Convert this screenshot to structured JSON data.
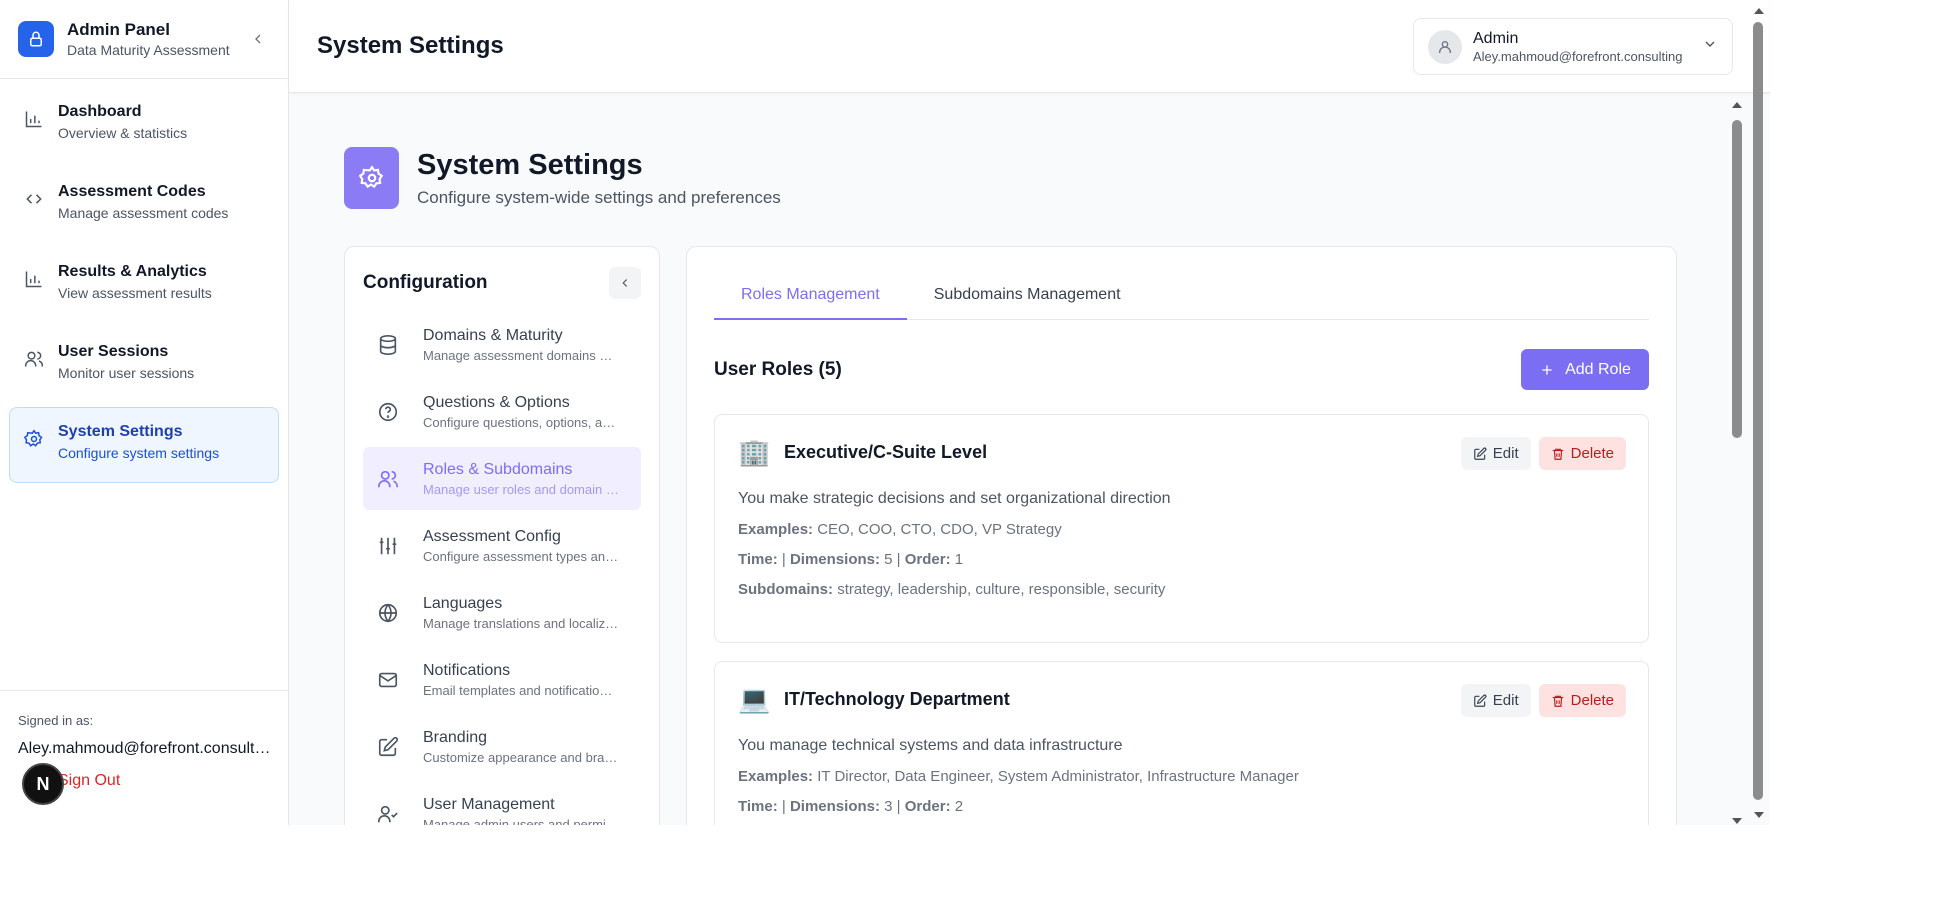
{
  "brand": {
    "title": "Admin Panel",
    "subtitle": "Data Maturity Assessment"
  },
  "sidebar": {
    "items": [
      {
        "title": "Dashboard",
        "desc": "Overview & statistics",
        "icon": "bar-chart-icon"
      },
      {
        "title": "Assessment Codes",
        "desc": "Manage assessment codes",
        "icon": "code-icon"
      },
      {
        "title": "Results & Analytics",
        "desc": "View assessment results",
        "icon": "bar-chart-icon"
      },
      {
        "title": "User Sessions",
        "desc": "Monitor user sessions",
        "icon": "users-icon"
      },
      {
        "title": "System Settings",
        "desc": "Configure system settings",
        "icon": "gear-icon",
        "active": true
      }
    ],
    "signed_label": "Signed in as:",
    "signed_email": "Aley.mahmoud@forefront.consulting",
    "signout": "Sign Out",
    "badge": "N"
  },
  "header": {
    "title": "System Settings",
    "user_name": "Admin",
    "user_email": "Aley.mahmoud@forefront.consulting"
  },
  "page": {
    "title": "System Settings",
    "subtitle": "Configure system-wide settings and preferences"
  },
  "config": {
    "title": "Configuration",
    "items": [
      {
        "title": "Domains & Maturity",
        "desc": "Manage assessment domains and maturity levels",
        "icon": "database-icon"
      },
      {
        "title": "Questions & Options",
        "desc": "Configure questions, options, and scoring",
        "icon": "help-circle-icon"
      },
      {
        "title": "Roles & Subdomains",
        "desc": "Manage user roles and domain mappings",
        "icon": "users-icon",
        "active": true
      },
      {
        "title": "Assessment Config",
        "desc": "Configure assessment types and settings",
        "icon": "sliders-icon"
      },
      {
        "title": "Languages",
        "desc": "Manage translations and localization",
        "icon": "globe-icon"
      },
      {
        "title": "Notifications",
        "desc": "Email templates and notification settings",
        "icon": "mail-icon"
      },
      {
        "title": "Branding",
        "desc": "Customize appearance and branding",
        "icon": "edit-icon"
      },
      {
        "title": "User Management",
        "desc": "Manage admin users and permissions",
        "icon": "user-check-icon"
      }
    ]
  },
  "tabs": {
    "roles": "Roles Management",
    "subdomains": "Subdomains Management"
  },
  "roles": {
    "heading": "User Roles (5)",
    "add_label": "Add Role",
    "edit_label": "Edit",
    "delete_label": "Delete",
    "labels": {
      "examples": "Examples:",
      "time": "Time:",
      "dimensions": "Dimensions:",
      "order": "Order:",
      "subdomains": "Subdomains:"
    },
    "items": [
      {
        "emoji": "🏢",
        "name": "Executive/C-Suite Level",
        "desc": "You make strategic decisions and set organizational direction",
        "examples": "CEO, COO, CTO, CDO, VP Strategy",
        "dimensions": "5",
        "order": "1",
        "subdomains": "strategy, leadership, culture, responsible, security"
      },
      {
        "emoji": "💻",
        "name": "IT/Technology Department",
        "desc": "You manage technical systems and data infrastructure",
        "examples": "IT Director, Data Engineer, System Administrator, Infrastructure Manager",
        "dimensions": "3",
        "order": "2",
        "subdomains": ""
      }
    ]
  },
  "colors": {
    "brand_blue": "#2563eb",
    "accent_purple": "#7c6ef2",
    "danger": "#dc2626"
  }
}
